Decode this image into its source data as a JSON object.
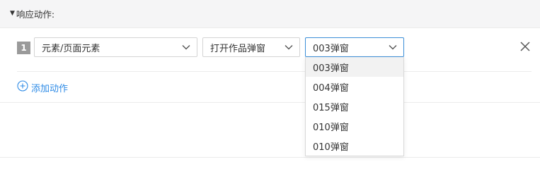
{
  "section": {
    "title": "响应动作:"
  },
  "action_row": {
    "step_number": "1",
    "target_select": {
      "value": "元素/页面元素"
    },
    "action_select": {
      "value": "打开作品弹窗"
    },
    "popup_select": {
      "value": "003弹窗",
      "options": [
        "003弹窗",
        "004弹窗",
        "015弹窗",
        "010弹窗",
        "010弹窗"
      ],
      "highlighted_index": 0
    }
  },
  "add_action": {
    "label": "添加动作"
  },
  "colors": {
    "accent": "#2e8be6",
    "focus_border": "#3b8ed8",
    "header_bg": "#f5f5f6",
    "badge_bg": "#9a9a9a"
  },
  "icons": {
    "caret": "caret-down-icon",
    "chevron": "chevron-down-icon",
    "close": "close-icon",
    "add": "plus-circle-icon"
  }
}
